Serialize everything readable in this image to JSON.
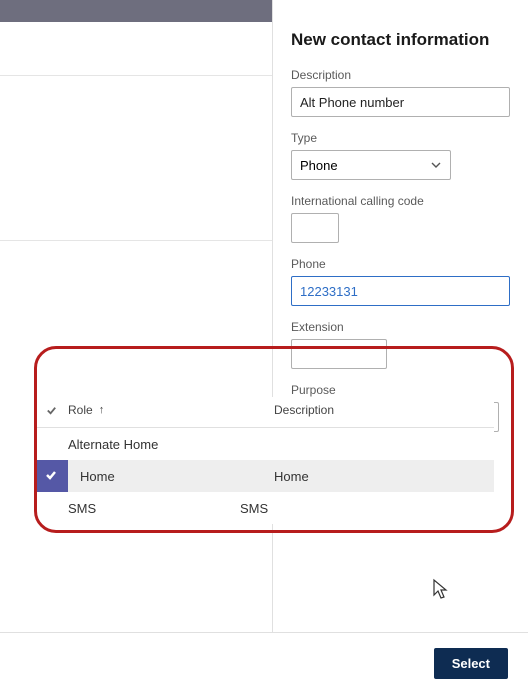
{
  "panel": {
    "title": "New contact information",
    "description_label": "Description",
    "description_value": "Alt Phone number",
    "type_label": "Type",
    "type_value": "Phone",
    "intl_code_label": "International calling code",
    "intl_code_value": "",
    "phone_label": "Phone",
    "phone_value": "12233131",
    "extension_label": "Extension",
    "extension_value": "",
    "purpose_label": "Purpose",
    "purpose_value": "Home"
  },
  "dropdown": {
    "col_role": "Role",
    "col_description": "Description",
    "rows": [
      {
        "role": "Alternate Home",
        "description": "",
        "selected": false
      },
      {
        "role": "Home",
        "description": "Home",
        "selected": true
      },
      {
        "role": "SMS",
        "description": "SMS",
        "selected": false
      }
    ]
  },
  "footer": {
    "select_label": "Select"
  }
}
